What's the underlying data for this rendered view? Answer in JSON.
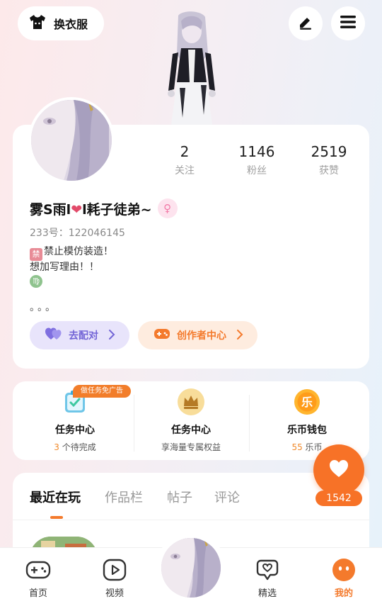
{
  "header": {
    "wardrobe_label": "换衣服",
    "edit_icon": "pen-icon",
    "menu_icon": "menu-icon"
  },
  "profile": {
    "following_count": "2",
    "following_label": "关注",
    "fans_count": "1146",
    "fans_label": "粉丝",
    "likes_count": "2519",
    "likes_label": "获赞",
    "name_prefix": "雾S雨l",
    "name_suffix": "l耗子徒弟~",
    "gender_symbol": "♀",
    "uid": "233号：122046145",
    "bio_badge": "禁",
    "bio_line1": "禁止模仿装造！",
    "bio_line2": "想加写理由！！",
    "bio_zodiac": "♍",
    "bio_dots": "。。。",
    "match_label": "去配对",
    "creator_label": "创作者中心"
  },
  "tasks": {
    "ad_tag": "做任务免广告",
    "items": [
      {
        "title": "任务中心",
        "sub_prefix": "",
        "sub_highlight": "3",
        "sub_suffix": " 个待完成"
      },
      {
        "title": "任务中心",
        "sub_prefix": "享海量专属权益",
        "sub_highlight": "",
        "sub_suffix": ""
      },
      {
        "title": "乐币钱包",
        "sub_prefix": "",
        "sub_highlight": "55",
        "sub_suffix": " 乐币"
      }
    ],
    "coin_glyph": "乐"
  },
  "like": {
    "count": "1542"
  },
  "tabs": [
    {
      "label": "最近在玩",
      "active": true
    },
    {
      "label": "作品栏",
      "active": false
    },
    {
      "label": "帖子",
      "active": false
    },
    {
      "label": "评论",
      "active": false
    }
  ],
  "nav": [
    {
      "label": "首页",
      "icon": "gamepad-icon",
      "active": false
    },
    {
      "label": "视频",
      "icon": "video-icon",
      "active": false
    },
    {
      "label": "精选",
      "icon": "heart-chat-icon",
      "active": false
    },
    {
      "label": "我的",
      "icon": "profile-face-icon",
      "active": true
    }
  ],
  "colors": {
    "accent": "#f47a2c",
    "match": "#7365d6",
    "gender": "#f27aa7"
  }
}
